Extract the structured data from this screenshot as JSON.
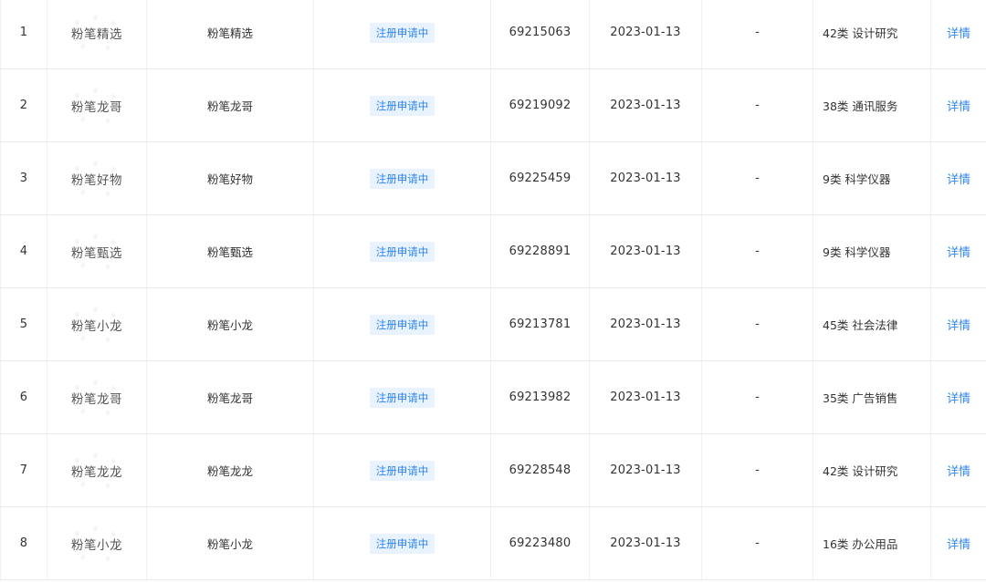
{
  "rows": [
    {
      "index": "1",
      "image_text": "粉笔精选",
      "name": "粉笔精选",
      "status": "注册申请中",
      "reg_no": "69215063",
      "date": "2023-01-13",
      "dash": "-",
      "class": "42类 设计研究",
      "action": "详情"
    },
    {
      "index": "2",
      "image_text": "粉笔龙哥",
      "name": "粉笔龙哥",
      "status": "注册申请中",
      "reg_no": "69219092",
      "date": "2023-01-13",
      "dash": "-",
      "class": "38类 通讯服务",
      "action": "详情"
    },
    {
      "index": "3",
      "image_text": "粉笔好物",
      "name": "粉笔好物",
      "status": "注册申请中",
      "reg_no": "69225459",
      "date": "2023-01-13",
      "dash": "-",
      "class": "9类 科学仪器",
      "action": "详情"
    },
    {
      "index": "4",
      "image_text": "粉笔甄选",
      "name": "粉笔甄选",
      "status": "注册申请中",
      "reg_no": "69228891",
      "date": "2023-01-13",
      "dash": "-",
      "class": "9类 科学仪器",
      "action": "详情"
    },
    {
      "index": "5",
      "image_text": "粉笔小龙",
      "name": "粉笔小龙",
      "status": "注册申请中",
      "reg_no": "69213781",
      "date": "2023-01-13",
      "dash": "-",
      "class": "45类 社会法律",
      "action": "详情"
    },
    {
      "index": "6",
      "image_text": "粉笔龙哥",
      "name": "粉笔龙哥",
      "status": "注册申请中",
      "reg_no": "69213982",
      "date": "2023-01-13",
      "dash": "-",
      "class": "35类 广告销售",
      "action": "详情"
    },
    {
      "index": "7",
      "image_text": "粉笔龙龙",
      "name": "粉笔龙龙",
      "status": "注册申请中",
      "reg_no": "69228548",
      "date": "2023-01-13",
      "dash": "-",
      "class": "42类 设计研究",
      "action": "详情"
    },
    {
      "index": "8",
      "image_text": "粉笔小龙",
      "name": "粉笔小龙",
      "status": "注册申请中",
      "reg_no": "69223480",
      "date": "2023-01-13",
      "dash": "-",
      "class": "16类 办公用品",
      "action": "详情"
    }
  ],
  "colors": {
    "link": "#2f86ee",
    "badge_bg": "#e8f3ff",
    "border": "#e8ecf1"
  }
}
